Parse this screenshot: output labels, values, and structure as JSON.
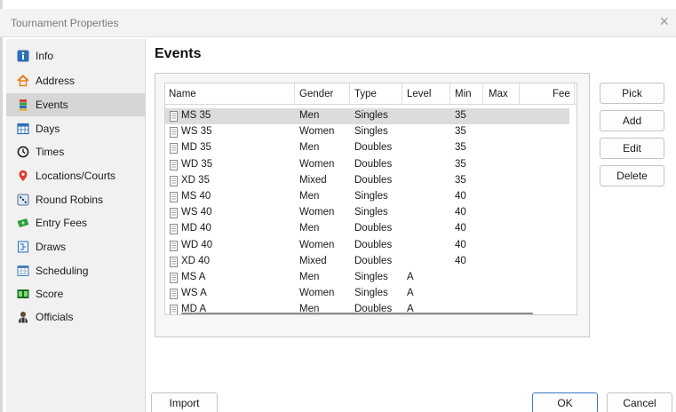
{
  "window": {
    "title": "Tournament Properties",
    "close_glyph": "×"
  },
  "sidebar": {
    "items": [
      {
        "label": "Info",
        "icon": "info-icon",
        "active": false
      },
      {
        "label": "Address",
        "icon": "home-icon",
        "active": false
      },
      {
        "label": "Events",
        "icon": "events-icon",
        "active": true
      },
      {
        "label": "Days",
        "icon": "calendar-icon",
        "active": false
      },
      {
        "label": "Times",
        "icon": "clock-icon",
        "active": false
      },
      {
        "label": "Locations/Courts",
        "icon": "location-pin-icon",
        "active": false
      },
      {
        "label": "Round Robins",
        "icon": "dice-icon",
        "active": false
      },
      {
        "label": "Entry Fees",
        "icon": "money-icon",
        "active": false
      },
      {
        "label": "Draws",
        "icon": "draw-sheet-icon",
        "active": false
      },
      {
        "label": "Scheduling",
        "icon": "schedule-icon",
        "active": false
      },
      {
        "label": "Score",
        "icon": "scoreboard-icon",
        "active": false
      },
      {
        "label": "Officials",
        "icon": "official-icon",
        "active": false
      }
    ]
  },
  "main": {
    "heading": "Events",
    "columns": [
      "Name",
      "Gender",
      "Type",
      "Level",
      "Min",
      "Max",
      "Fee"
    ],
    "rows": [
      {
        "name": "MS 35",
        "gender": "Men",
        "type": "Singles",
        "level": "",
        "min": "35",
        "max": "",
        "fee": ""
      },
      {
        "name": "WS 35",
        "gender": "Women",
        "type": "Singles",
        "level": "",
        "min": "35",
        "max": "",
        "fee": ""
      },
      {
        "name": "MD 35",
        "gender": "Men",
        "type": "Doubles",
        "level": "",
        "min": "35",
        "max": "",
        "fee": ""
      },
      {
        "name": "WD 35",
        "gender": "Women",
        "type": "Doubles",
        "level": "",
        "min": "35",
        "max": "",
        "fee": ""
      },
      {
        "name": "XD 35",
        "gender": "Mixed",
        "type": "Doubles",
        "level": "",
        "min": "35",
        "max": "",
        "fee": ""
      },
      {
        "name": "MS 40",
        "gender": "Men",
        "type": "Singles",
        "level": "",
        "min": "40",
        "max": "",
        "fee": ""
      },
      {
        "name": "WS 40",
        "gender": "Women",
        "type": "Singles",
        "level": "",
        "min": "40",
        "max": "",
        "fee": ""
      },
      {
        "name": "MD 40",
        "gender": "Men",
        "type": "Doubles",
        "level": "",
        "min": "40",
        "max": "",
        "fee": ""
      },
      {
        "name": "WD 40",
        "gender": "Women",
        "type": "Doubles",
        "level": "",
        "min": "40",
        "max": "",
        "fee": ""
      },
      {
        "name": "XD 40",
        "gender": "Mixed",
        "type": "Doubles",
        "level": "",
        "min": "40",
        "max": "",
        "fee": ""
      },
      {
        "name": "MS A",
        "gender": "Men",
        "type": "Singles",
        "level": "A",
        "min": "",
        "max": "",
        "fee": ""
      },
      {
        "name": "WS A",
        "gender": "Women",
        "type": "Singles",
        "level": "A",
        "min": "",
        "max": "",
        "fee": ""
      },
      {
        "name": "MD A",
        "gender": "Men",
        "type": "Doubles",
        "level": "A",
        "min": "",
        "max": "",
        "fee": ""
      }
    ],
    "selected_row": 0
  },
  "actions": {
    "pick": "Pick",
    "add": "Add",
    "edit": "Edit",
    "delete": "Delete"
  },
  "footer": {
    "import": "Import",
    "ok": "OK",
    "cancel": "Cancel"
  }
}
